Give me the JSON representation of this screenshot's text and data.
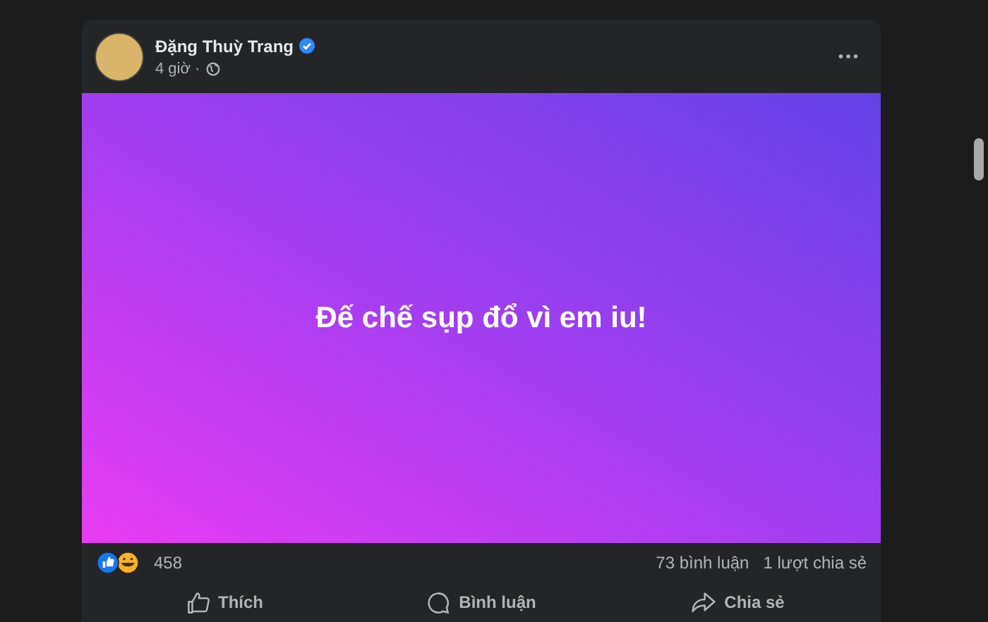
{
  "post": {
    "author": "Đặng Thuỳ Trang",
    "verified": true,
    "time": "4 giờ ·",
    "public": true,
    "text": "Đế chế sụp đổ vì em iu!",
    "reactions_count": "458",
    "comments": "73 bình luận",
    "shares": "1 lượt chia sẻ"
  },
  "actions": [
    {
      "kind": "like",
      "label": "Thích"
    },
    {
      "kind": "comment",
      "label": "Bình luận"
    },
    {
      "kind": "share",
      "label": "Chia sẻ"
    }
  ]
}
